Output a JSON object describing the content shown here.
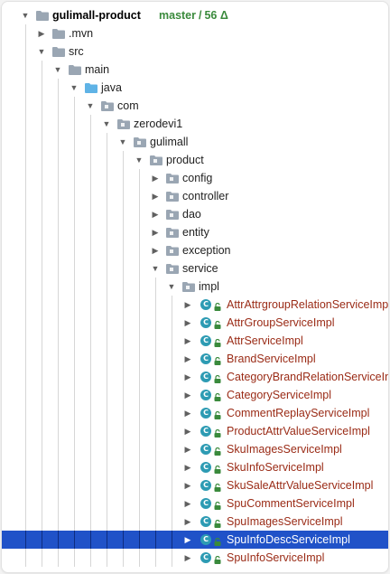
{
  "project": {
    "name": "gulimall-product",
    "vcs_branch": "master",
    "vcs_separator": "/",
    "vcs_changes": "56 Δ"
  },
  "tree": {
    "folders": {
      "mvn": ".mvn",
      "src": "src",
      "main": "main",
      "java": "java",
      "com": "com",
      "zerodevi1": "zerodevi1",
      "gulimall": "gulimall",
      "product": "product",
      "config": "config",
      "controller": "controller",
      "dao": "dao",
      "entity": "entity",
      "exception": "exception",
      "service": "service",
      "impl": "impl"
    },
    "classes": [
      "AttrAttrgroupRelationServiceImpl",
      "AttrGroupServiceImpl",
      "AttrServiceImpl",
      "BrandServiceImpl",
      "CategoryBrandRelationServiceImpl",
      "CategoryServiceImpl",
      "CommentReplayServiceImpl",
      "ProductAttrValueServiceImpl",
      "SkuImagesServiceImpl",
      "SkuInfoServiceImpl",
      "SkuSaleAttrValueServiceImpl",
      "SpuCommentServiceImpl",
      "SpuImagesServiceImpl",
      "SpuInfoDescServiceImpl",
      "SpuInfoServiceImpl"
    ],
    "class_icon_letter": "C",
    "selected_class": "SpuInfoDescServiceImpl"
  },
  "colors": {
    "folder": "#9aa6b3",
    "source_folder": "#5fb3e6",
    "class_icon": "#2d9bb3",
    "class_text": "#9a2b16",
    "selection": "#2052c8",
    "vcs": "#3a8a3c"
  },
  "icons": {
    "expanded": "triangle-down-icon",
    "collapsed": "triangle-right-icon",
    "folder": "folder-icon",
    "package": "package-icon",
    "class": "class-icon",
    "lock": "lock-icon"
  }
}
